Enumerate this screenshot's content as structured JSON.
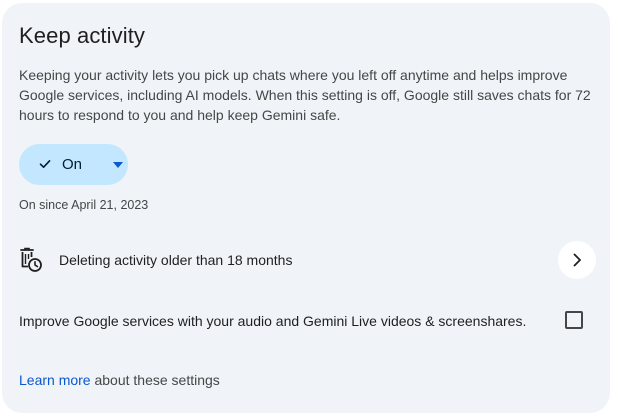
{
  "card": {
    "title": "Keep activity",
    "description": "Keeping your activity lets you pick up chats where you left off anytime and helps improve Google services, including AI models. When this setting is off, Google still saves chats for 72 hours to respond to you and help keep Gemini safe.",
    "toggle": {
      "label": "On",
      "icon": "check-icon",
      "dropdown_icon": "caret-down-icon"
    },
    "status_text": "On since April 21, 2023",
    "auto_delete": {
      "icon": "trash-clock-icon",
      "label": "Deleting activity older than 18 months",
      "action_icon": "chevron-right-icon"
    },
    "improve_option": {
      "label": "Improve Google services with your audio and Gemini Live videos & screenshares.",
      "checked": false
    },
    "footer": {
      "link_text": "Learn more",
      "rest_text": " about these settings"
    }
  },
  "colors": {
    "card_bg": "#f0f4f9",
    "toggle_bg": "#c2e7ff",
    "link": "#0b57d0",
    "text_primary": "#1f1f1f",
    "text_secondary": "#444746"
  }
}
